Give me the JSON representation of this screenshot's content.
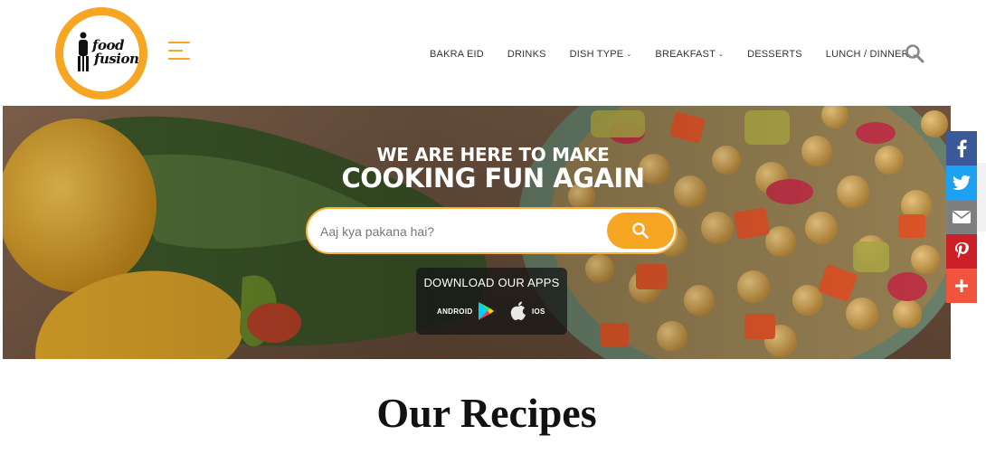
{
  "brand": {
    "logo_line1": "food",
    "logo_line2": "fusion"
  },
  "nav": {
    "items": [
      {
        "label": "BAKRA EID",
        "dropdown": false
      },
      {
        "label": "DRINKS",
        "dropdown": false
      },
      {
        "label": "DISH TYPE",
        "dropdown": true
      },
      {
        "label": "BREAKFAST",
        "dropdown": true
      },
      {
        "label": "DESSERTS",
        "dropdown": false
      },
      {
        "label": "LUNCH / DINNER",
        "dropdown": true
      }
    ]
  },
  "hero": {
    "headline_line1": "WE ARE HERE TO MAKE",
    "headline_line2": "COOKING FUN AGAIN",
    "search_placeholder": "Aaj kya pakana hai?",
    "apps_title": "DOWNLOAD OUR APPS",
    "android_label": "ANDROID",
    "ios_label": "IOS"
  },
  "share": [
    "facebook-icon",
    "twitter-icon",
    "email-icon",
    "pinterest-icon",
    "more-share-icon"
  ],
  "section": {
    "title": "Our Recipes"
  },
  "colors": {
    "accent": "#f6a623",
    "facebook": "#3b5998",
    "twitter": "#1da1f2",
    "email": "#7f7f7f",
    "pinterest": "#cb2027",
    "more": "#f0543c"
  }
}
